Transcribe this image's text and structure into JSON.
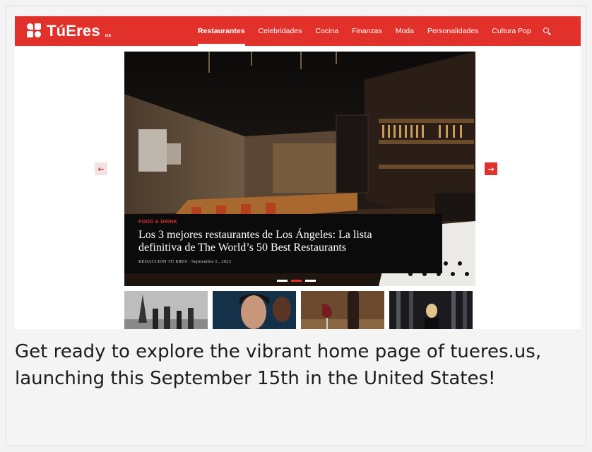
{
  "header": {
    "logo_text": "TúEres",
    "logo_suffix": "us",
    "nav": [
      {
        "label": "Restaurantes",
        "active": true
      },
      {
        "label": "Celebridades",
        "active": false
      },
      {
        "label": "Cocina",
        "active": false
      },
      {
        "label": "Finanzas",
        "active": false
      },
      {
        "label": "Moda",
        "active": false
      },
      {
        "label": "Personalidades",
        "active": false
      },
      {
        "label": "Cultura Pop",
        "active": false
      }
    ],
    "search_icon": "search-icon"
  },
  "hero": {
    "category": "FOOD & DRINK",
    "title_line1": "Los 3 mejores restaurantes de Los Ángeles: La lista",
    "title_line2": "definitiva de The World’s 50 Best Restaurants",
    "meta": "REDACCIÓN TÚ ERES · Septiembre 5 , 2023",
    "prev_icon": "arrow-left-icon",
    "next_icon": "arrow-right-icon",
    "prev_glyph": "←",
    "next_glyph": "→",
    "slides": 3,
    "active_slide": 2
  },
  "thumbnails": [
    "eiffel-tower-thumbnail",
    "celebrities-thumbnail",
    "wine-thumbnail",
    "bar-interior-thumbnail"
  ],
  "post": {
    "text": "Get ready to explore the vibrant home page of tueres.us, launching this September 15th in the United States!"
  },
  "colors": {
    "brand_red": "#e1312a",
    "caption_bg": "#0b0b0b",
    "page_bg": "#f4f4f4"
  }
}
